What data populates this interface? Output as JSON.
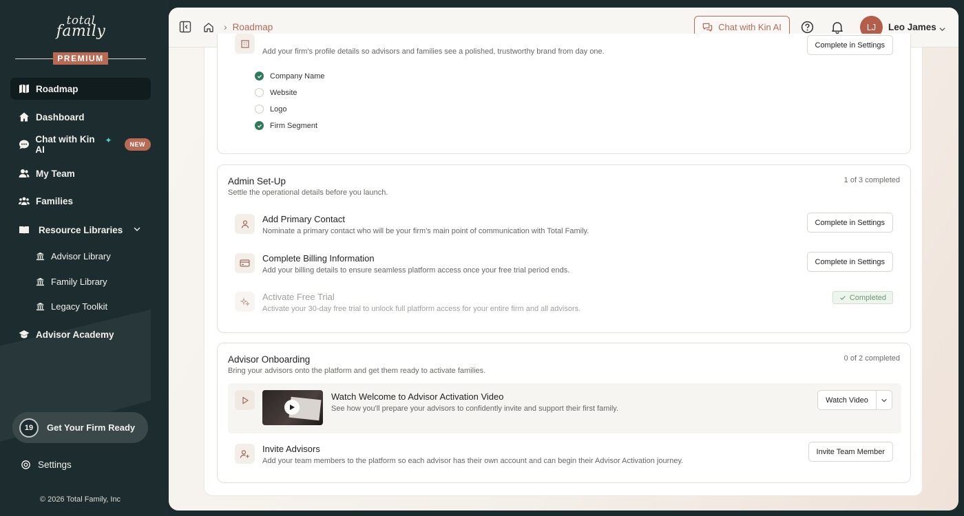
{
  "brand": {
    "logo_line1": "total",
    "logo_line2": "family",
    "tier_badge": "PREMIUM"
  },
  "sidebar": {
    "items": [
      {
        "label": "Roadmap",
        "icon": "map-icon",
        "active": true
      },
      {
        "label": "Dashboard",
        "icon": "home-icon"
      },
      {
        "label": "Chat with Kin AI",
        "icon": "chat-bubble-icon",
        "badge": "NEW"
      },
      {
        "label": "My Team",
        "icon": "users-icon"
      },
      {
        "label": "Families",
        "icon": "family-icon"
      },
      {
        "label": "Resource Libraries",
        "icon": "book-icon"
      },
      {
        "label": "Advisor Academy",
        "icon": "graduation-cap-icon"
      }
    ],
    "sub_items": [
      {
        "label": "Advisor Library",
        "icon": "library-icon"
      },
      {
        "label": "Family Library",
        "icon": "library-icon"
      },
      {
        "label": "Legacy Toolkit",
        "icon": "library-icon"
      }
    ],
    "firm_ready": {
      "count": "19",
      "label": "Get Your Firm Ready"
    },
    "settings_label": "Settings",
    "copyright": "© 2026 Total Family, Inc"
  },
  "topbar": {
    "breadcrumb": "Roadmap",
    "chat_button": "Chat with Kin AI",
    "user_initials": "LJ",
    "user_name": "Leo James"
  },
  "profile_card": {
    "description": "Add your firm's profile details so advisors and families see a polished, trustworthy brand from day one.",
    "button": "Complete in Settings",
    "checklist": [
      {
        "label": "Company Name",
        "done": true
      },
      {
        "label": "Website",
        "done": false
      },
      {
        "label": "Logo",
        "done": false
      },
      {
        "label": "Firm Segment",
        "done": true
      }
    ]
  },
  "admin_card": {
    "title": "Admin Set-Up",
    "subtitle": "Settle the operational details before you launch.",
    "count": "1 of 3 completed",
    "tasks": [
      {
        "title": "Add Primary Contact",
        "desc": "Nominate a primary contact who will be your firm's main point of communication with Total Family.",
        "button": "Complete in Settings",
        "icon": "person-icon"
      },
      {
        "title": "Complete Billing Information",
        "desc": "Add your billing details to ensure seamless platform access once your free trial period ends.",
        "button": "Complete in Settings",
        "icon": "credit-card-icon"
      },
      {
        "title": "Activate Free Trial",
        "desc": "Activate your 30-day free trial to unlock full platform access for your entire firm and all advisors.",
        "status": "Completed",
        "icon": "sparkles-icon"
      }
    ]
  },
  "onboarding_card": {
    "title": "Advisor Onboarding",
    "subtitle": "Bring your advisors onto the platform and get them ready to activate families.",
    "count": "0 of 2 completed",
    "tasks": [
      {
        "title": "Watch Welcome to Advisor Activation Video",
        "desc": "See how you'll prepare your advisors to confidently invite and support their first family.",
        "button": "Watch Video",
        "icon": "play-icon"
      },
      {
        "title": "Invite Advisors",
        "desc": "Add your team members to the platform so each advisor has their own account and can begin their Advisor Activation journey.",
        "button": "Invite Team Member",
        "icon": "user-plus-icon"
      }
    ]
  },
  "colors": {
    "sidebar_bg": "#1d2c2e",
    "accent": "#b86a55",
    "success": "#2f7a5b"
  }
}
